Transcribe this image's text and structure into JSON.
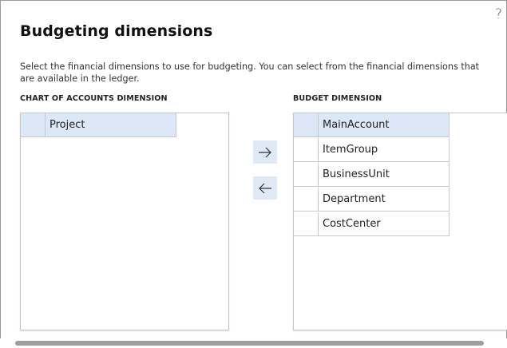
{
  "dialog": {
    "title": "Budgeting dimensions",
    "description": "Select the financial dimensions to use for budgeting. You can select from the financial dimensions that are available in the ledger.",
    "help_icon": "question-mark-icon"
  },
  "chart_of_accounts": {
    "label": "CHART OF ACCOUNTS DIMENSION",
    "items": [
      {
        "label": "Project",
        "selected": true
      }
    ]
  },
  "budget": {
    "label": "BUDGET DIMENSION",
    "items": [
      {
        "label": "MainAccount",
        "selected": true
      },
      {
        "label": "ItemGroup",
        "selected": false
      },
      {
        "label": "BusinessUnit",
        "selected": false
      },
      {
        "label": "Department",
        "selected": false
      },
      {
        "label": "CostCenter",
        "selected": false
      }
    ]
  },
  "buttons": {
    "move_right_icon": "arrow-right-icon",
    "move_left_icon": "arrow-left-icon"
  },
  "colors": {
    "selected_row": "#dce8f7",
    "button_bg": "#dfeaf6"
  }
}
